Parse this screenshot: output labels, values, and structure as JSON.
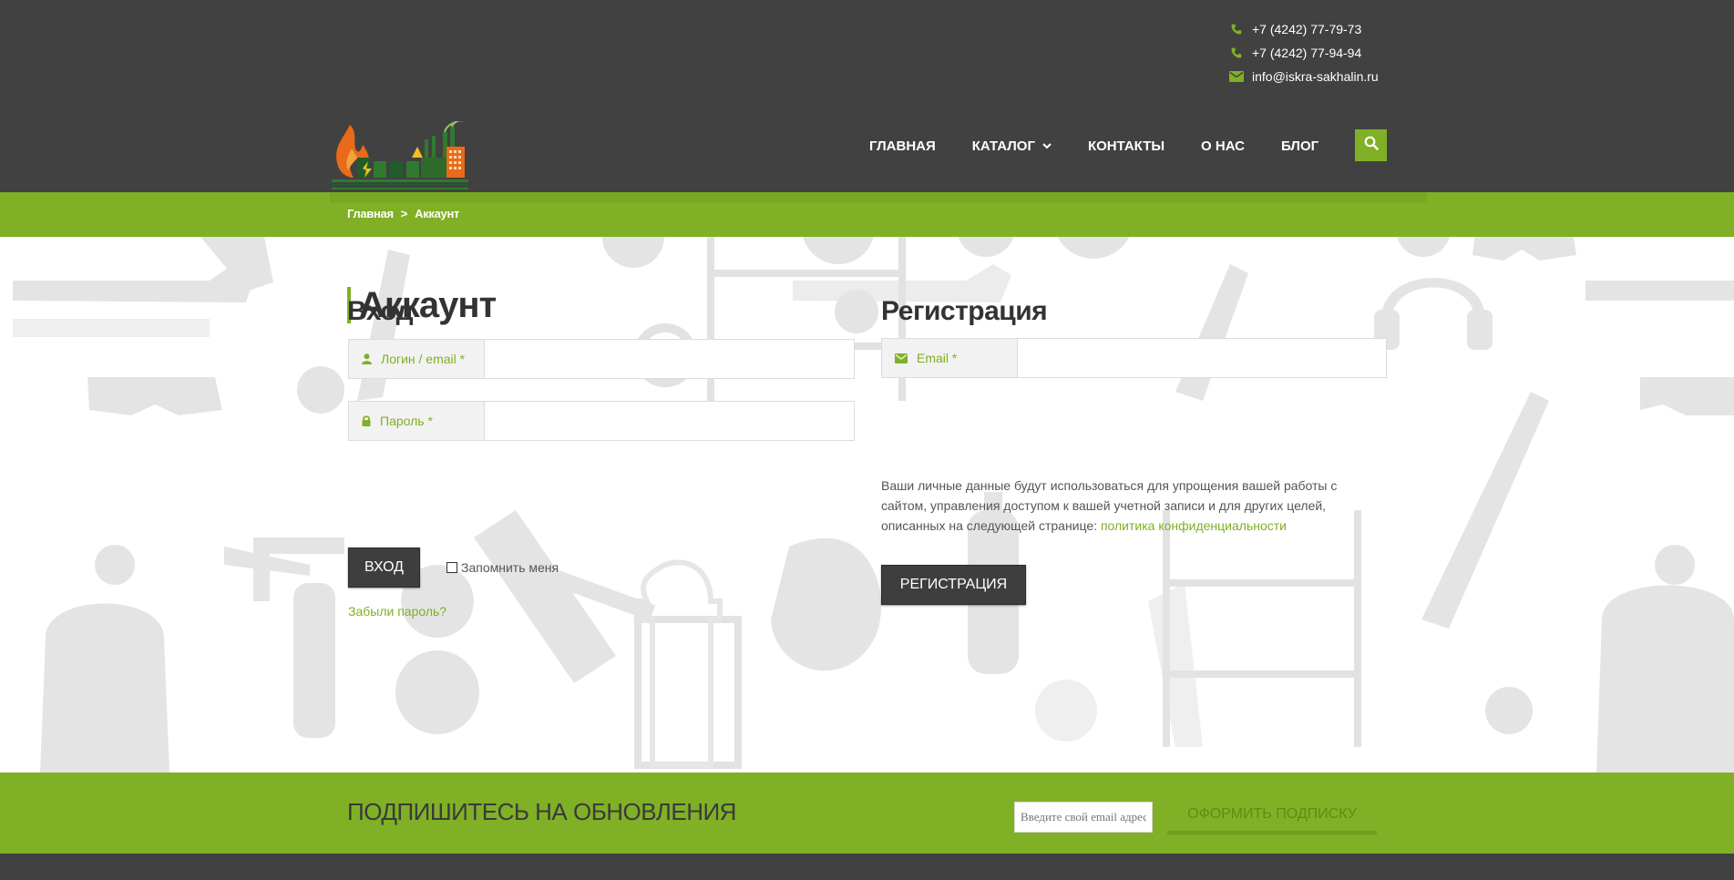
{
  "header": {
    "phone1": "+7 (4242) 77-79-73",
    "phone2": "+7 (4242) 77-94-94",
    "email": "info@iskra-sakhalin.ru",
    "icons": {
      "phone": "phone-icon",
      "mail": "mail-icon",
      "search": "search-icon",
      "caret": "chevron-down-icon"
    },
    "colors": {
      "bar": "#414141",
      "accent": "#80b025",
      "text": "#ffffff"
    }
  },
  "nav": {
    "home": "ГЛАВНАЯ",
    "catalog": "КАТАЛОГ",
    "contacts": "КОНТАКТЫ",
    "about": "О НАС",
    "blog": "БЛОГ"
  },
  "breadcrumb": {
    "home": "Главная",
    "separator": ">",
    "current": "Аккаунт"
  },
  "page": {
    "title": "Аккаунт"
  },
  "login": {
    "title": "Вход",
    "login_label": "Логин / email *",
    "password_label": "Пароль *",
    "login_value": "",
    "password_value": "",
    "submit": "ВХОД",
    "remember": "Запомнить меня",
    "forgot": "Забыли пароль?"
  },
  "register": {
    "title": "Регистрация",
    "email_label": "Email *",
    "email_value": "",
    "privacy_text": "Ваши личные данные будут использоваться для упрощения вашей работы с сайтом, управления доступом к вашей учетной записи и для других целей, описанных на следующей странице:",
    "privacy_link": "политика конфиденциальности",
    "submit": "РЕГИСТРАЦИЯ"
  },
  "subscribe": {
    "title": "ПОДПИШИТЕСЬ НА ОБНОВЛЕНИЯ",
    "placeholder": "Введите свой email адрес",
    "button": "ОФОРМИТЬ ПОДПИСКУ"
  }
}
